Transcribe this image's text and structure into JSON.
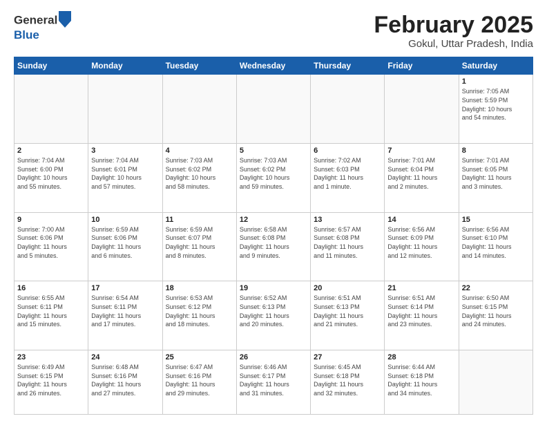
{
  "header": {
    "logo_line1": "General",
    "logo_line2": "Blue",
    "title": "February 2025",
    "subtitle": "Gokul, Uttar Pradesh, India"
  },
  "days_of_week": [
    "Sunday",
    "Monday",
    "Tuesday",
    "Wednesday",
    "Thursday",
    "Friday",
    "Saturday"
  ],
  "weeks": [
    [
      {
        "day": "",
        "info": ""
      },
      {
        "day": "",
        "info": ""
      },
      {
        "day": "",
        "info": ""
      },
      {
        "day": "",
        "info": ""
      },
      {
        "day": "",
        "info": ""
      },
      {
        "day": "",
        "info": ""
      },
      {
        "day": "1",
        "info": "Sunrise: 7:05 AM\nSunset: 5:59 PM\nDaylight: 10 hours\nand 54 minutes."
      }
    ],
    [
      {
        "day": "2",
        "info": "Sunrise: 7:04 AM\nSunset: 6:00 PM\nDaylight: 10 hours\nand 55 minutes."
      },
      {
        "day": "3",
        "info": "Sunrise: 7:04 AM\nSunset: 6:01 PM\nDaylight: 10 hours\nand 57 minutes."
      },
      {
        "day": "4",
        "info": "Sunrise: 7:03 AM\nSunset: 6:02 PM\nDaylight: 10 hours\nand 58 minutes."
      },
      {
        "day": "5",
        "info": "Sunrise: 7:03 AM\nSunset: 6:02 PM\nDaylight: 10 hours\nand 59 minutes."
      },
      {
        "day": "6",
        "info": "Sunrise: 7:02 AM\nSunset: 6:03 PM\nDaylight: 11 hours\nand 1 minute."
      },
      {
        "day": "7",
        "info": "Sunrise: 7:01 AM\nSunset: 6:04 PM\nDaylight: 11 hours\nand 2 minutes."
      },
      {
        "day": "8",
        "info": "Sunrise: 7:01 AM\nSunset: 6:05 PM\nDaylight: 11 hours\nand 3 minutes."
      }
    ],
    [
      {
        "day": "9",
        "info": "Sunrise: 7:00 AM\nSunset: 6:06 PM\nDaylight: 11 hours\nand 5 minutes."
      },
      {
        "day": "10",
        "info": "Sunrise: 6:59 AM\nSunset: 6:06 PM\nDaylight: 11 hours\nand 6 minutes."
      },
      {
        "day": "11",
        "info": "Sunrise: 6:59 AM\nSunset: 6:07 PM\nDaylight: 11 hours\nand 8 minutes."
      },
      {
        "day": "12",
        "info": "Sunrise: 6:58 AM\nSunset: 6:08 PM\nDaylight: 11 hours\nand 9 minutes."
      },
      {
        "day": "13",
        "info": "Sunrise: 6:57 AM\nSunset: 6:08 PM\nDaylight: 11 hours\nand 11 minutes."
      },
      {
        "day": "14",
        "info": "Sunrise: 6:56 AM\nSunset: 6:09 PM\nDaylight: 11 hours\nand 12 minutes."
      },
      {
        "day": "15",
        "info": "Sunrise: 6:56 AM\nSunset: 6:10 PM\nDaylight: 11 hours\nand 14 minutes."
      }
    ],
    [
      {
        "day": "16",
        "info": "Sunrise: 6:55 AM\nSunset: 6:11 PM\nDaylight: 11 hours\nand 15 minutes."
      },
      {
        "day": "17",
        "info": "Sunrise: 6:54 AM\nSunset: 6:11 PM\nDaylight: 11 hours\nand 17 minutes."
      },
      {
        "day": "18",
        "info": "Sunrise: 6:53 AM\nSunset: 6:12 PM\nDaylight: 11 hours\nand 18 minutes."
      },
      {
        "day": "19",
        "info": "Sunrise: 6:52 AM\nSunset: 6:13 PM\nDaylight: 11 hours\nand 20 minutes."
      },
      {
        "day": "20",
        "info": "Sunrise: 6:51 AM\nSunset: 6:13 PM\nDaylight: 11 hours\nand 21 minutes."
      },
      {
        "day": "21",
        "info": "Sunrise: 6:51 AM\nSunset: 6:14 PM\nDaylight: 11 hours\nand 23 minutes."
      },
      {
        "day": "22",
        "info": "Sunrise: 6:50 AM\nSunset: 6:15 PM\nDaylight: 11 hours\nand 24 minutes."
      }
    ],
    [
      {
        "day": "23",
        "info": "Sunrise: 6:49 AM\nSunset: 6:15 PM\nDaylight: 11 hours\nand 26 minutes."
      },
      {
        "day": "24",
        "info": "Sunrise: 6:48 AM\nSunset: 6:16 PM\nDaylight: 11 hours\nand 27 minutes."
      },
      {
        "day": "25",
        "info": "Sunrise: 6:47 AM\nSunset: 6:16 PM\nDaylight: 11 hours\nand 29 minutes."
      },
      {
        "day": "26",
        "info": "Sunrise: 6:46 AM\nSunset: 6:17 PM\nDaylight: 11 hours\nand 31 minutes."
      },
      {
        "day": "27",
        "info": "Sunrise: 6:45 AM\nSunset: 6:18 PM\nDaylight: 11 hours\nand 32 minutes."
      },
      {
        "day": "28",
        "info": "Sunrise: 6:44 AM\nSunset: 6:18 PM\nDaylight: 11 hours\nand 34 minutes."
      },
      {
        "day": "",
        "info": ""
      }
    ]
  ]
}
